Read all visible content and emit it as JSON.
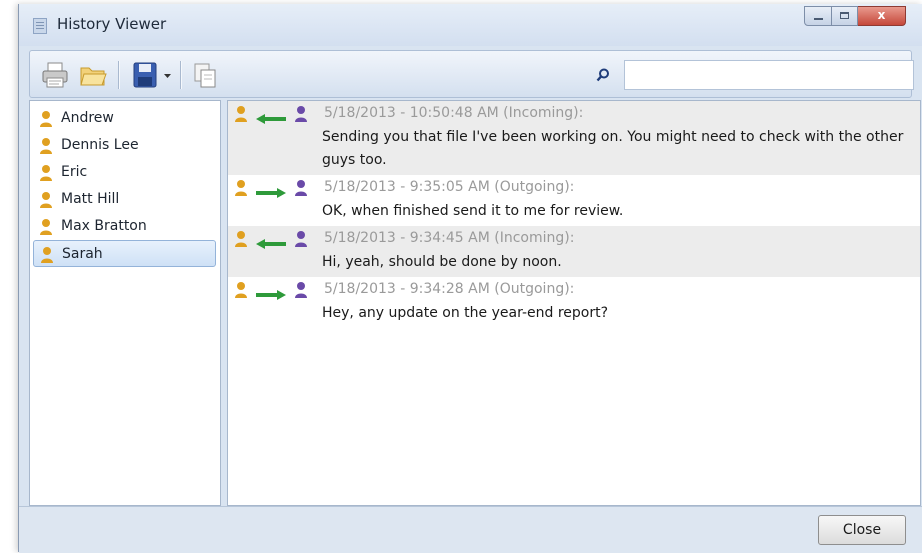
{
  "window": {
    "title": "History Viewer",
    "close_glyph": "x"
  },
  "toolbar": {
    "icons": [
      "printer-icon",
      "folder-open-icon",
      "save-icon",
      "dropdown-arrow-icon",
      "copy-icon",
      "search-icon"
    ],
    "search": {
      "value": "",
      "placeholder": ""
    }
  },
  "contacts": [
    {
      "name": "Andrew",
      "selected": false
    },
    {
      "name": "Dennis Lee",
      "selected": false
    },
    {
      "name": "Eric",
      "selected": false
    },
    {
      "name": "Matt Hill",
      "selected": false
    },
    {
      "name": "Max Bratton",
      "selected": false
    },
    {
      "name": "Sarah",
      "selected": true
    }
  ],
  "messages": [
    {
      "direction": "incoming",
      "meta": "5/18/2013 - 10:50:48 AM (Incoming):",
      "text": "Sending you that file I've been working on. You might need to check with the other guys too.",
      "shaded": true
    },
    {
      "direction": "outgoing",
      "meta": "5/18/2013 - 9:35:05 AM (Outgoing):",
      "text": "OK, when finished send it to me for review.",
      "shaded": false
    },
    {
      "direction": "incoming",
      "meta": "5/18/2013 - 9:34:45 AM (Incoming):",
      "text": "Hi, yeah, should be done by noon.",
      "shaded": true
    },
    {
      "direction": "outgoing",
      "meta": "5/18/2013 - 9:34:28 AM (Outgoing):",
      "text": "Hey, any update on the year-end report?",
      "shaded": false
    }
  ],
  "footer": {
    "close_label": "Close"
  },
  "colors": {
    "arrow": "#2e9a3a",
    "person_orange": "#e0a020",
    "person_purple": "#6a4aa8",
    "meta_text": "#9a9a9a"
  }
}
